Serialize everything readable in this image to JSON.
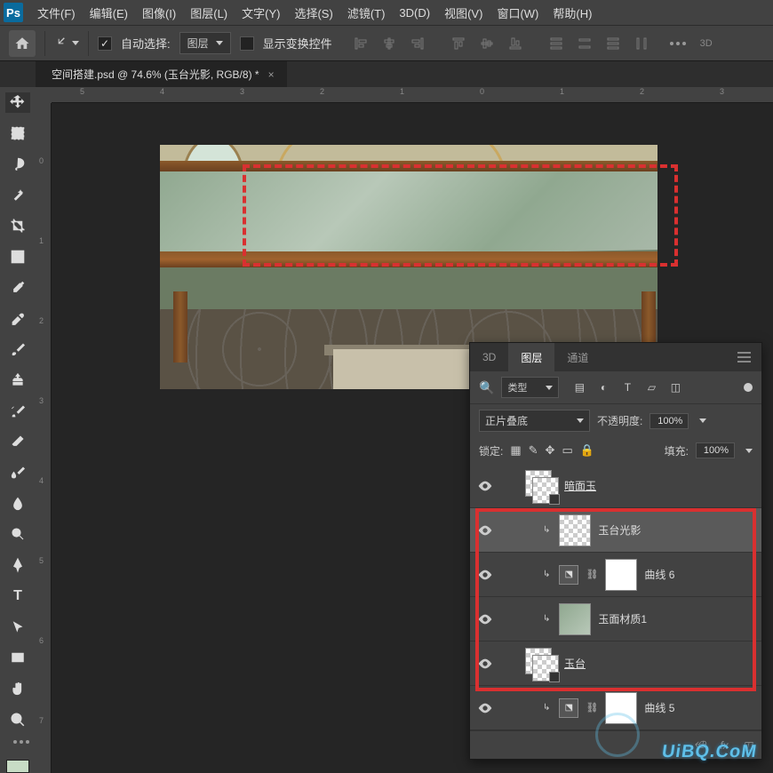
{
  "menubar": {
    "items": [
      "文件(F)",
      "编辑(E)",
      "图像(I)",
      "图层(L)",
      "文字(Y)",
      "选择(S)",
      "滤镜(T)",
      "3D(D)",
      "视图(V)",
      "窗口(W)",
      "帮助(H)"
    ]
  },
  "optbar": {
    "auto_select_label": "自动选择:",
    "auto_select_target": "图层",
    "show_transform_label": "显示变换控件",
    "td_label": "3D"
  },
  "doc": {
    "tab_title": "空间搭建.psd @ 74.6% (玉台光影, RGB/8) *"
  },
  "ruler": {
    "h_ticks": [
      "5",
      "4",
      "3",
      "2",
      "1",
      "0",
      "1",
      "2",
      "3"
    ],
    "v_ticks": [
      "0",
      "1",
      "2",
      "3",
      "4",
      "5",
      "6",
      "7"
    ]
  },
  "panel": {
    "tabs": {
      "td": "3D",
      "layers": "图层",
      "channels": "通道"
    },
    "filter_type": "类型",
    "blend_mode": "正片叠底",
    "opacity_label": "不透明度:",
    "opacity_value": "100%",
    "lock_label": "锁定:",
    "fill_label": "填充:",
    "fill_value": "100%",
    "layers": [
      {
        "name": "暗面玉",
        "indent": 0,
        "clip": false,
        "thumb": "group",
        "underline": true
      },
      {
        "name": "玉台光影",
        "indent": 1,
        "clip": true,
        "thumb": "checker",
        "selected": true
      },
      {
        "name": "曲线 6",
        "indent": 1,
        "clip": true,
        "thumb": "adjustment"
      },
      {
        "name": "玉面材质1",
        "indent": 1,
        "clip": true,
        "thumb": "marble"
      },
      {
        "name": "玉台",
        "indent": 0,
        "clip": false,
        "thumb": "group",
        "underline": true
      },
      {
        "name": "曲线 5",
        "indent": 1,
        "clip": true,
        "thumb": "adjustment"
      }
    ],
    "footer_fx": "fx"
  },
  "watermark": "UiBQ.CoM"
}
